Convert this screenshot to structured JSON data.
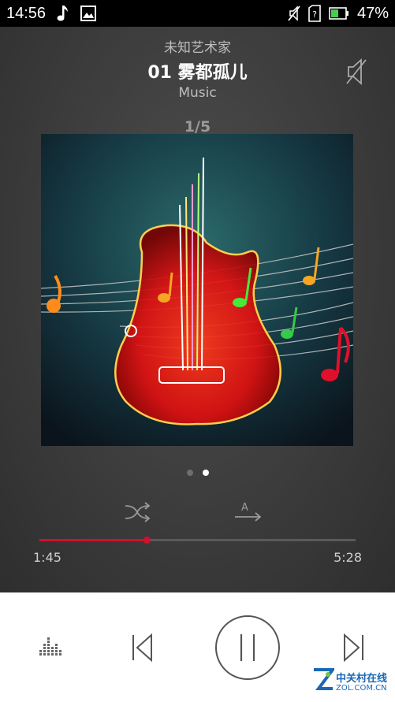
{
  "status_bar": {
    "time": "14:56",
    "battery_percent": "47%",
    "left_icons": [
      "music-note-icon",
      "gallery-icon"
    ],
    "right_icons": [
      "mute-ringer-icon",
      "sim-unknown-icon",
      "battery-icon"
    ]
  },
  "player": {
    "artist": "未知艺术家",
    "title": "01 雾都孤儿",
    "album": "Music",
    "counter": "1/5",
    "page_dots": 2,
    "active_dot": 1,
    "progress_fraction": 0.34,
    "elapsed": "1:45",
    "total": "5:28"
  },
  "controls": {
    "buttons": [
      "equalizer-icon",
      "previous-icon",
      "pause-icon",
      "next-icon"
    ]
  },
  "watermark": {
    "name": "中关村在线",
    "url": "ZOL.COM.CN"
  },
  "colors": {
    "accent": "#d2102a",
    "status_bar": "#000000",
    "controls_bg": "#ffffff"
  }
}
